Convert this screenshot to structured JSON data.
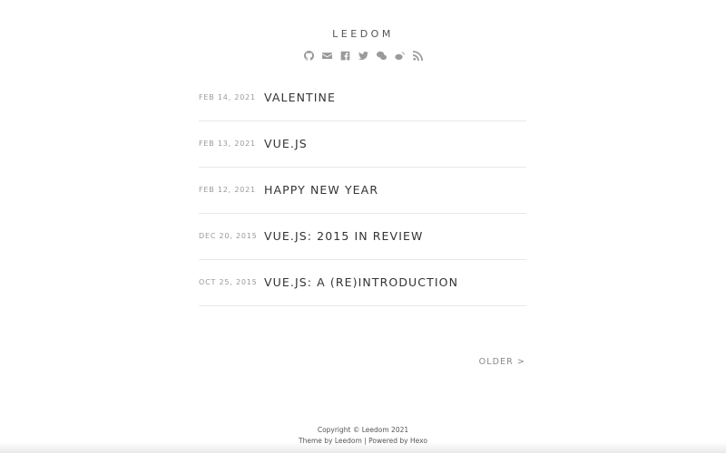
{
  "site": {
    "title": "LEEDOM"
  },
  "social_icons": [
    {
      "icon": "github-icon"
    },
    {
      "icon": "mail-icon"
    },
    {
      "icon": "facebook-icon"
    },
    {
      "icon": "twitter-icon"
    },
    {
      "icon": "wechat-icon"
    },
    {
      "icon": "weibo-icon"
    },
    {
      "icon": "rss-icon"
    }
  ],
  "posts": [
    {
      "date": "FEB 14, 2021",
      "title": "VALENTINE"
    },
    {
      "date": "FEB 13, 2021",
      "title": "VUE.JS"
    },
    {
      "date": "FEB 12, 2021",
      "title": "HAPPY NEW YEAR"
    },
    {
      "date": "DEC 20, 2015",
      "title": "VUE.JS: 2015 IN REVIEW"
    },
    {
      "date": "OCT 25, 2015",
      "title": "VUE.JS: A (RE)INTRODUCTION"
    }
  ],
  "pagination": {
    "older_label": "OLDER >"
  },
  "footer": {
    "copyright": "Copyright © Leedom 2021",
    "theme_prefix": "Theme by",
    "theme_author": "Leedom",
    "separator": "|",
    "powered_prefix": "Powered by",
    "powered_by": "Hexo"
  }
}
